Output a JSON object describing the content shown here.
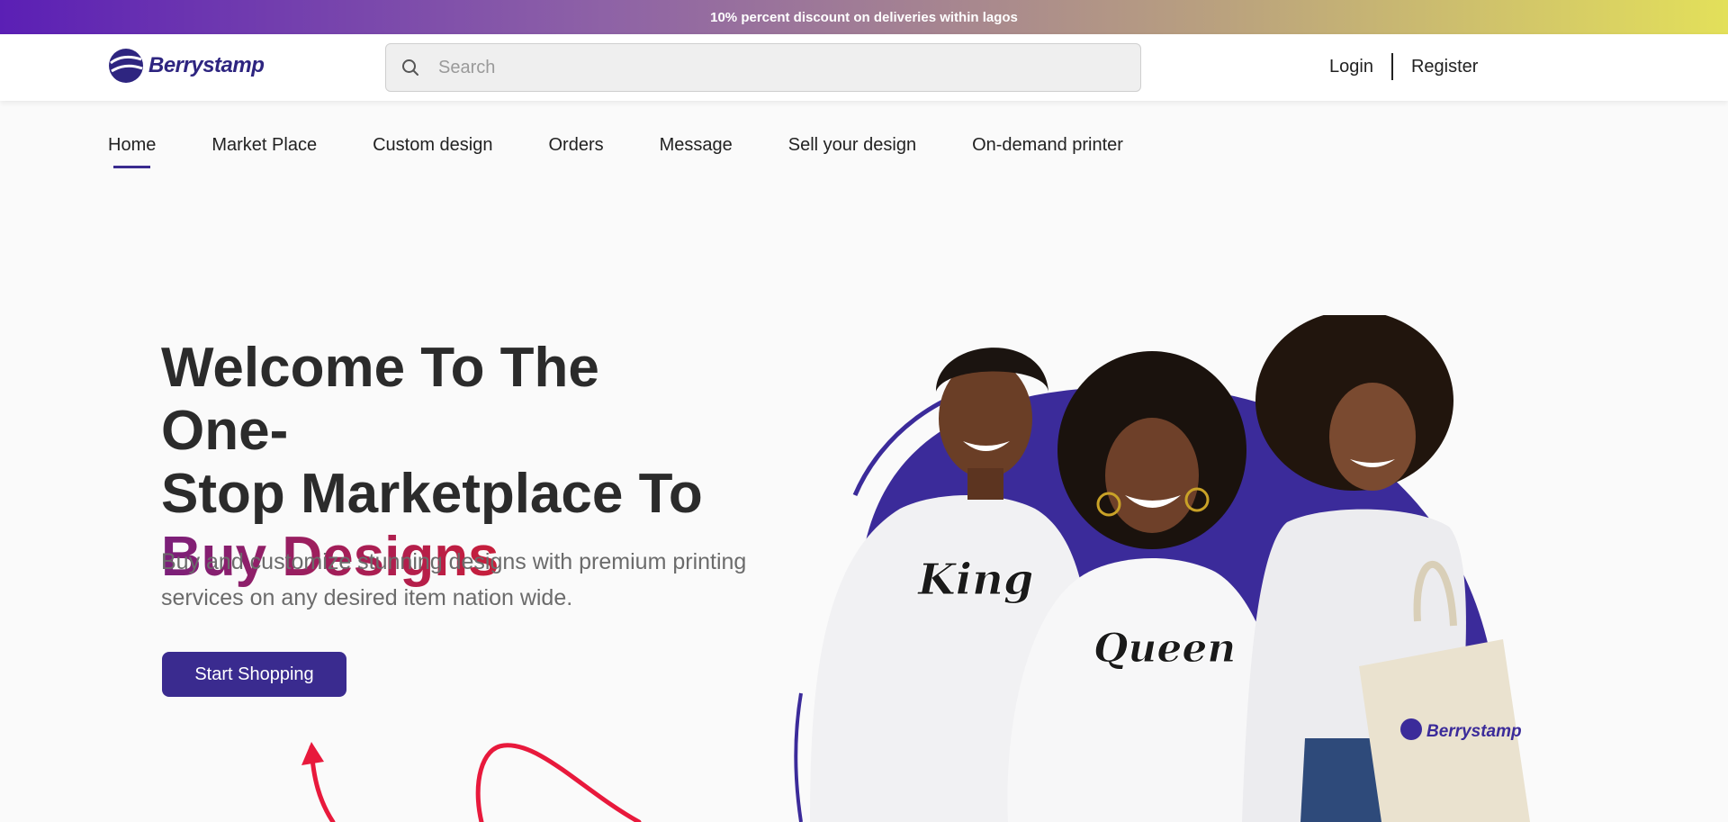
{
  "promo": {
    "text": "10% percent discount on deliveries within lagos"
  },
  "brand": {
    "name": "Berrystamp",
    "color": "#2e2580"
  },
  "search": {
    "placeholder": "Search",
    "value": ""
  },
  "auth": {
    "login": "Login",
    "register": "Register"
  },
  "nav": {
    "items": [
      {
        "label": "Home",
        "active": true
      },
      {
        "label": "Market Place"
      },
      {
        "label": "Custom design"
      },
      {
        "label": "Orders"
      },
      {
        "label": "Message"
      },
      {
        "label": "Sell your design"
      },
      {
        "label": "On-demand printer"
      }
    ]
  },
  "hero": {
    "title_line1": "Welcome To The One-",
    "title_line2": "Stop Marketplace To",
    "title_accent": "Buy Designs",
    "subtitle": "Buy and customize stunning designs with premium printing services on any desired item nation wide.",
    "cta": "Start Shopping",
    "shirt_text_1": "King",
    "shirt_text_2": "Queen",
    "bag_text": "Berrystamp"
  },
  "colors": {
    "accent": "#3a2b8f",
    "highlight_start": "#7a1f7a",
    "highlight_end": "#c81e3a"
  }
}
